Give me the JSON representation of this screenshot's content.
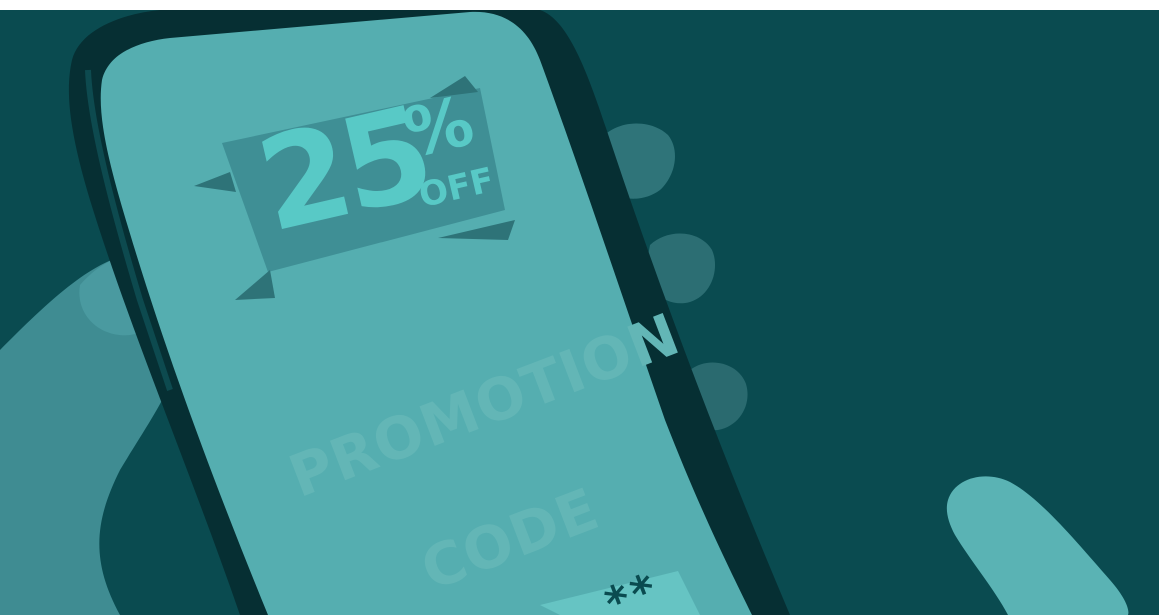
{
  "discount": {
    "number": "25",
    "percent_sign": "%",
    "off_label": "OFF"
  },
  "promotion": {
    "line1": "PROMOTION",
    "line2": "CODE",
    "code_mask": "**"
  },
  "colors": {
    "background": "#0a4b50",
    "screen": "#55aeb0",
    "banner": "#3f8f95",
    "accent_text": "#58c9c6",
    "screen_text": "#63b6b6",
    "hand": "#3f8c92"
  }
}
